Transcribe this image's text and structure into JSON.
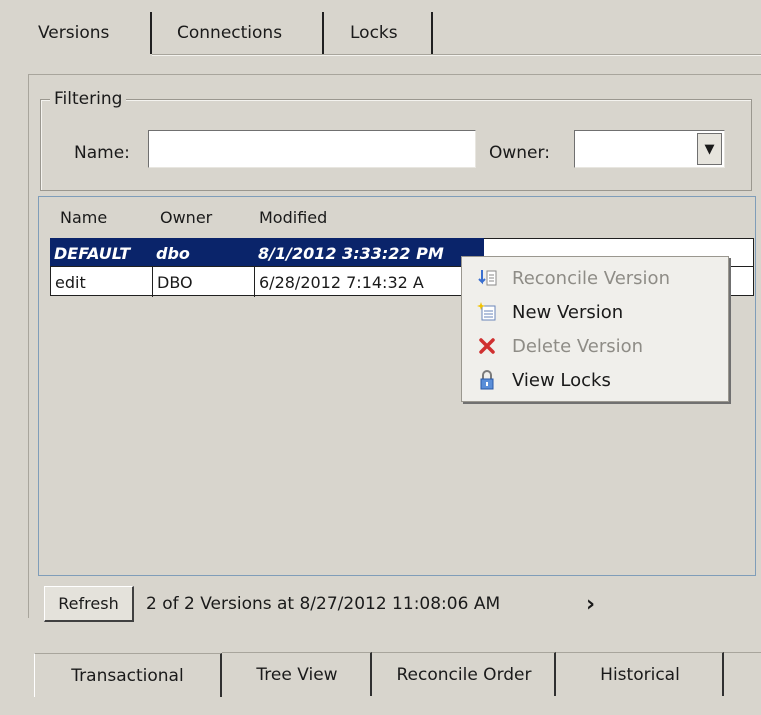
{
  "top_tabs": [
    {
      "label": "Versions"
    },
    {
      "label": "Connections"
    },
    {
      "label": "Locks"
    }
  ],
  "filtering": {
    "title": "Filtering",
    "name_label": "Name:",
    "name_value": "",
    "owner_label": "Owner:",
    "owner_value": "",
    "dropdown_glyph": "▼"
  },
  "list": {
    "columns": [
      "Name",
      "Owner",
      "Modified"
    ],
    "rows": [
      {
        "name": "DEFAULT",
        "owner": "dbo",
        "modified": "8/1/2012 3:33:22 PM",
        "selected": true
      },
      {
        "name": "edit",
        "owner": "DBO",
        "modified": "6/28/2012 7:14:32 A",
        "selected": false
      }
    ]
  },
  "context_menu": {
    "items": [
      {
        "label": "Reconcile Version",
        "icon": "reconcile-icon",
        "enabled": false
      },
      {
        "label": "New Version",
        "icon": "new-version-icon",
        "enabled": true
      },
      {
        "label": "Delete Version",
        "icon": "delete-icon",
        "enabled": false
      },
      {
        "label": "View Locks",
        "icon": "lock-icon",
        "enabled": true
      }
    ]
  },
  "footer": {
    "refresh_label": "Refresh",
    "status_text": "2 of 2 Versions at 8/27/2012 11:08:06 AM",
    "chevron": "›"
  },
  "bottom_tabs": [
    {
      "label": "Transactional",
      "active": true
    },
    {
      "label": "Tree View",
      "active": false
    },
    {
      "label": "Reconcile Order",
      "active": false
    },
    {
      "label": "Historical",
      "active": false
    }
  ],
  "colors": {
    "background": "#d8d5cd",
    "selection": "#0a246a",
    "list_border": "#7f9db9",
    "disabled_text": "#8e8c86",
    "delete_red": "#d03030"
  }
}
